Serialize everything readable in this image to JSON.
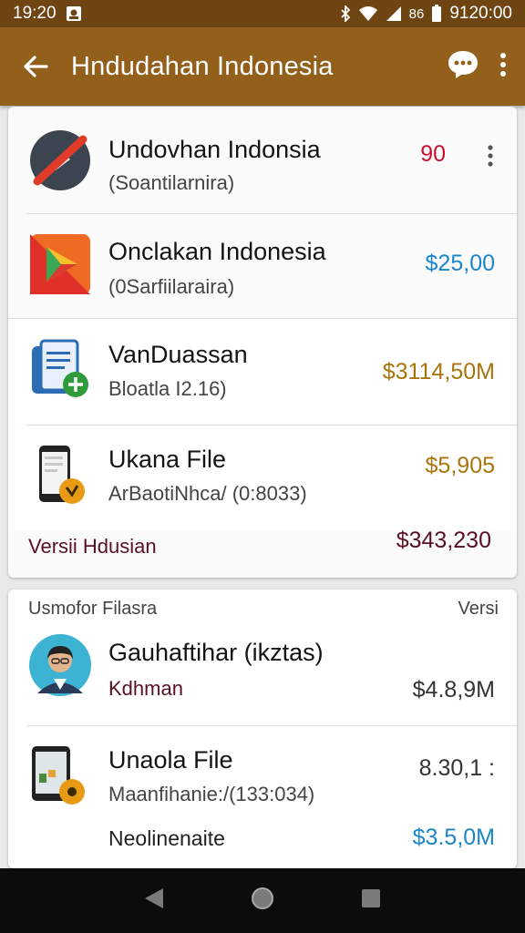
{
  "status": {
    "time_left": "19:20",
    "battery_text": "86",
    "time_right": "9120:00"
  },
  "app_bar": {
    "title": "Hndudahan Indonesia"
  },
  "card1": {
    "rows": [
      {
        "name": "Undovhan Indonsia",
        "sub": "(Soantilarnira)",
        "price": "90",
        "price_color": "#c8102e"
      },
      {
        "name": "Onclakan Indonesia",
        "sub": "(0Sarfiilaraira)",
        "price": "$25,00",
        "price_color": "#1a86c8"
      },
      {
        "name": "VanDuassan",
        "sub": "Bloatla I2.16)",
        "price": "$3114,50M",
        "price_color": "#a8750c"
      },
      {
        "name": "Ukana File",
        "sub": "ArBaotiNhca/ (0:8033)",
        "price": "$5,905",
        "price_color": "#a8750c"
      }
    ],
    "footer": {
      "label": "Versii Hdusian",
      "value": "$343,230",
      "value_color": "#5a1020"
    }
  },
  "card2": {
    "header": {
      "label": "Usmofor Filasra",
      "right": "Versi"
    },
    "rows": [
      {
        "name": "Gauhaftihar (ikztas)",
        "sub": "Kdhman",
        "price": "$4.8,9M",
        "price_color": "#333333"
      },
      {
        "name": "Unaola File",
        "sub": "Maanfihanie:/(133:034)",
        "price": "8.30,1 :",
        "price_color": "#333333"
      }
    ],
    "footer": {
      "label": "Neolinenaite",
      "value": "$3.5,0M",
      "value_color": "#1a86c8"
    }
  }
}
